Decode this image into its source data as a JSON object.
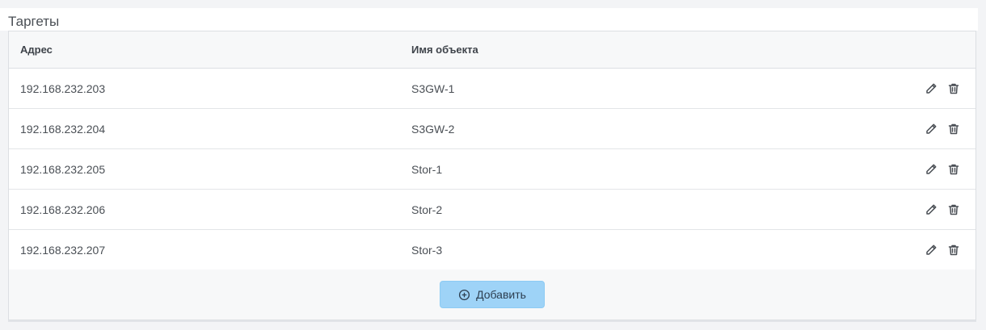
{
  "section": {
    "title": "Таргеты"
  },
  "table": {
    "columns": {
      "address": "Адрес",
      "object_name": "Имя объекта"
    },
    "rows": [
      {
        "address": "192.168.232.203",
        "name": "S3GW-1"
      },
      {
        "address": "192.168.232.204",
        "name": "S3GW-2"
      },
      {
        "address": "192.168.232.205",
        "name": "Stor-1"
      },
      {
        "address": "192.168.232.206",
        "name": "Stor-2"
      },
      {
        "address": "192.168.232.207",
        "name": "Stor-3"
      }
    ],
    "row_icons": [
      "pencil-icon",
      "trash-icon"
    ]
  },
  "footer": {
    "add_label": "Добавить",
    "add_icon": "plus-circle-icon"
  },
  "colors": {
    "accent": "#9ed3f7",
    "header_bg": "#f7f8f9",
    "border": "#dcdfe3"
  }
}
